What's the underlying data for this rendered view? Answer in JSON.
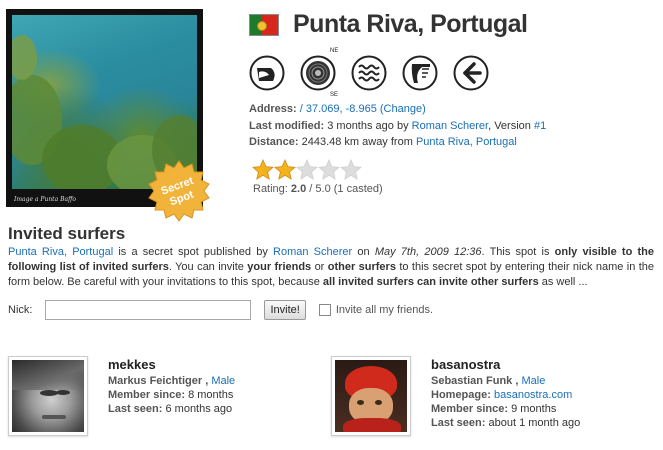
{
  "spot": {
    "name": "Punta Riva, Portugal",
    "photo_caption": "Image a Punta Baffo",
    "badge": [
      "Secret",
      "Spot"
    ]
  },
  "colors": {
    "link": "#1a6fb5",
    "badge": "#f2b33a",
    "star_on": "#f2b31e",
    "star_off": "#dddddd"
  },
  "icons": [
    "spot-type-icon",
    "wind-direction-icon",
    "wave-icon",
    "swell-direction-icon",
    "back-arrow-icon"
  ],
  "compass": {
    "top": "NE",
    "bottom": "SE"
  },
  "info": {
    "address_label": "Address:",
    "address_prefix": "/",
    "address_value": "37.069, -8.965",
    "address_change": "(Change)",
    "modified_label": "Last modified:",
    "modified_value": "3 months ago by",
    "modified_user": "Roman Scherer",
    "version_text": ", Version",
    "version_value": "#1",
    "distance_label": "Distance:",
    "distance_value": "2443.48 km away from",
    "distance_link": "Punta Riva, Portugal"
  },
  "rating": {
    "value": 2.0,
    "max": 5,
    "label": "Rating:",
    "value_text": "2.0",
    "suffix": "/ 5.0 (1 casted)"
  },
  "invited": {
    "title": "Invited surfers",
    "spot_link": "Punta Riva, Portugal",
    "t1": " is a secret spot published by ",
    "author": "Roman Scherer",
    "t2": " on ",
    "date": "May 7th, 2009 12:36",
    "t3": ". This spot is ",
    "b1": "only visible to the following list of invited surfers",
    "t4": ". You can invite ",
    "b2": "your friends",
    "t5": " or ",
    "b3": "other surfers",
    "t6": " to this secret spot by entering their nick name in the form below. Be careful with your invitations to this spot, because ",
    "b4": "all invited surfers can invite other surfers",
    "t7": " as well ..."
  },
  "form": {
    "nick_label": "Nick:",
    "nick_value": "",
    "nick_placeholder": "",
    "invite_button": "Invite!",
    "invite_all_label": "Invite all my friends."
  },
  "surfers": [
    {
      "nick": "mekkes",
      "full_name": "Markus Feichtiger",
      "gender": "Male",
      "member_label": "Member since:",
      "member_value": "8 months",
      "seen_label": "Last seen:",
      "seen_value": "6 months ago"
    },
    {
      "nick": "basanostra",
      "full_name": "Sebastian Funk",
      "gender": "Male",
      "homepage_label": "Homepage:",
      "homepage_value": "basanostra.com",
      "member_label": "Member since:",
      "member_value": "9 months",
      "seen_label": "Last seen:",
      "seen_value": "about 1 month ago"
    }
  ]
}
